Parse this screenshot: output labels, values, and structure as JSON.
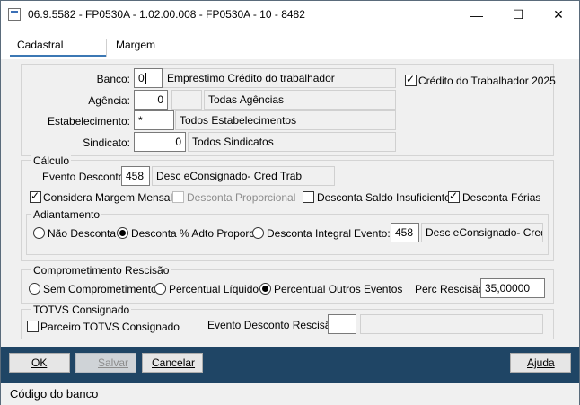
{
  "window": {
    "title": "06.9.5582 - FP0530A - 1.02.00.008 - FP0530A - 10 - 8482",
    "minimize": "—",
    "maximize": "☐",
    "close": "✕"
  },
  "tabs": [
    {
      "label": "Cadastral",
      "active": true
    },
    {
      "label": "Margem",
      "active": false
    }
  ],
  "header": {
    "banco_label": "Banco:",
    "banco_value": "0",
    "banco_desc": "Emprestimo Crédito do trabalhador",
    "credito_label": "Crédito do Trabalhador 2025",
    "credito_checked": true,
    "agencia_label": "Agência:",
    "agencia_value": "0",
    "agencia_extra": "",
    "agencia_desc": "Todas Agências",
    "estab_label": "Estabelecimento:",
    "estab_value": "*",
    "estab_desc": "Todos Estabelecimentos",
    "sindicato_label": "Sindicato:",
    "sindicato_value": "0",
    "sindicato_desc": "Todos Sindicatos"
  },
  "calculo": {
    "title": "Cálculo",
    "evento_label": "Evento Desconto:",
    "evento_value": "458",
    "evento_desc": "Desc eConsignado- Cred Trab",
    "considera_margem": "Considera Margem Mensal",
    "desconta_proporcional": "Desconta Proporcional",
    "desconta_saldo": "Desconta Saldo Insuficiente",
    "desconta_ferias": "Desconta Férias",
    "adiantamento": {
      "title": "Adiantamento",
      "nao_desconta": "Não Desconta",
      "desconta_adto": "Desconta % Adto Proporc",
      "desconta_integral": "Desconta Integral",
      "evento_label": "Evento:",
      "evento_value": "458",
      "evento_desc": "Desc eConsignado- Cred Tr"
    }
  },
  "rescisao": {
    "title": "Comprometimento Rescisão",
    "sem": "Sem Comprometimento",
    "liquido": "Percentual Líquido",
    "outros": "Percentual Outros Eventos",
    "perc_label": "Perc Rescisão:",
    "perc_value": "35,00000"
  },
  "totvs": {
    "title": "TOTVS Consignado",
    "parceiro": "Parceiro TOTVS Consignado",
    "evento_resc_label": "Evento Desconto Rescisão:",
    "evento_resc_value": "",
    "evento_resc_desc": ""
  },
  "buttons": {
    "ok": "OK",
    "salvar": "Salvar",
    "cancelar": "Cancelar",
    "ajuda": "Ajuda"
  },
  "status": "Código do banco"
}
